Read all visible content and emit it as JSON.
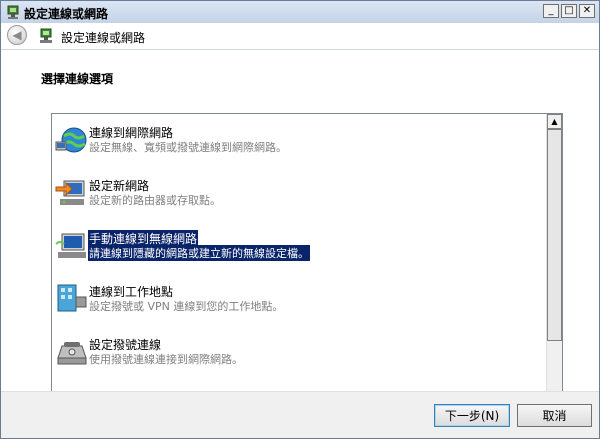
{
  "window": {
    "title": "設定連線或網路"
  },
  "titlebar": {
    "minimize": "_",
    "maximize": "□",
    "close": "✕"
  },
  "nav": {
    "back_glyph": "◀",
    "title": "設定連線或網路"
  },
  "main": {
    "heading": "選擇連線選項"
  },
  "options": [
    {
      "title": "連線到網際網路",
      "desc": "設定無線、寬頻或撥號連線到網際網路。",
      "icon": "globe-network-icon"
    },
    {
      "title": "設定新網路",
      "desc": "設定新的路由器或存取點。",
      "icon": "new-network-icon"
    },
    {
      "title": "手動連線到無線網路",
      "desc": "請連線到隱藏的網路或建立新的無線設定檔。",
      "icon": "wireless-network-icon",
      "selected": true
    },
    {
      "title": "連線到工作地點",
      "desc": "設定撥號或 VPN 連線到您的工作地點。",
      "icon": "workplace-icon"
    },
    {
      "title": "設定撥號連線",
      "desc": "使用撥號連線連接到網際網路。",
      "icon": "dialup-modem-icon"
    }
  ],
  "scrollbar": {
    "up": "▲",
    "down": "▼"
  },
  "buttons": {
    "next": "下一步(N)",
    "cancel": "取消"
  },
  "colors": {
    "selection": "#0a246a",
    "description": "#808080"
  }
}
